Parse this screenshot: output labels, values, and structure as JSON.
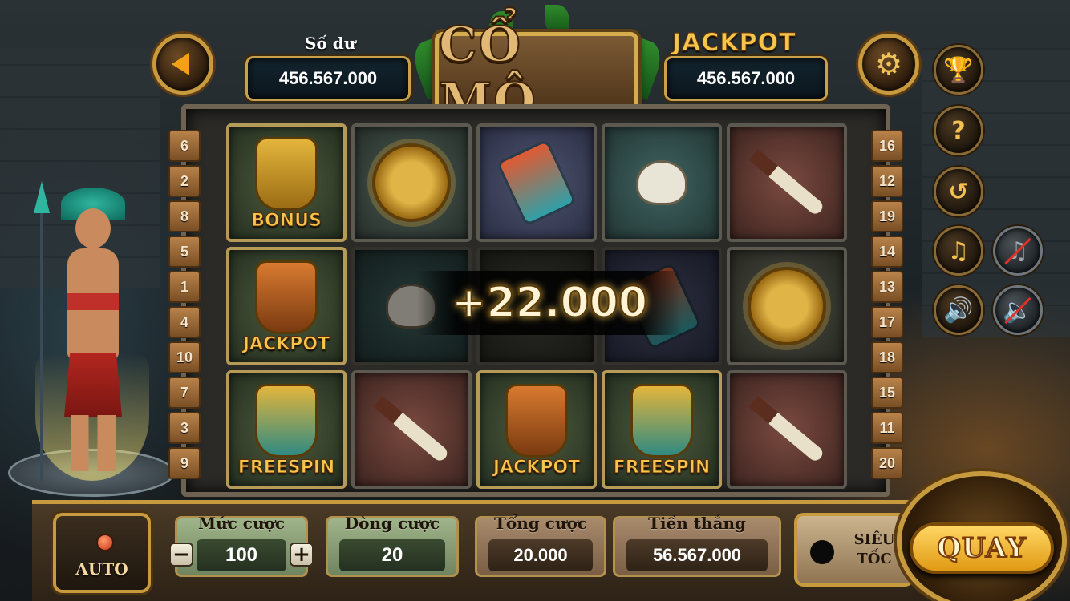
{
  "header": {
    "balance_label": "Số dư",
    "balance_value": "456.567.000",
    "jackpot_label": "JACKPOT",
    "jackpot_value": "456.567.000",
    "title": "CỔ MỘ"
  },
  "icons": {
    "back": "back-arrow-icon",
    "settings": "gear-icon",
    "trophy": "trophy-icon",
    "help": "question-icon",
    "history": "history-icon",
    "music": "music-icon",
    "music_off": "music-off-icon",
    "sound": "speaker-icon",
    "sound_off": "speaker-off-icon"
  },
  "side_buttons": {
    "help_glyph": "?"
  },
  "paylines": {
    "left": [
      "6",
      "2",
      "8",
      "5",
      "1",
      "4",
      "10",
      "7",
      "3",
      "9"
    ],
    "right": [
      "16",
      "12",
      "19",
      "14",
      "13",
      "17",
      "18",
      "15",
      "11",
      "20"
    ]
  },
  "reels": {
    "symbol_labels": {
      "bonus": "BONUS",
      "jackpot": "JACKPOT",
      "freespin": "FREESPIN"
    },
    "win_amount": "+22.000"
  },
  "controls": {
    "auto_label": "AUTO",
    "bet_label": "Mức cược",
    "bet_value": "100",
    "minus": "−",
    "plus": "+",
    "lines_label": "Dòng cược",
    "lines_value": "20",
    "total_bet_label": "Tổng cược",
    "total_bet_value": "20.000",
    "winnings_label": "Tiền thắng",
    "winnings_value": "56.567.000",
    "turbo_label_1": "SIÊU",
    "turbo_label_2": "TỐC",
    "spin_label": "QUAY"
  },
  "colors": {
    "gold": "#c79a3e",
    "jackpot_text": "#f6c64c",
    "spin_button": "#f3b43a"
  }
}
